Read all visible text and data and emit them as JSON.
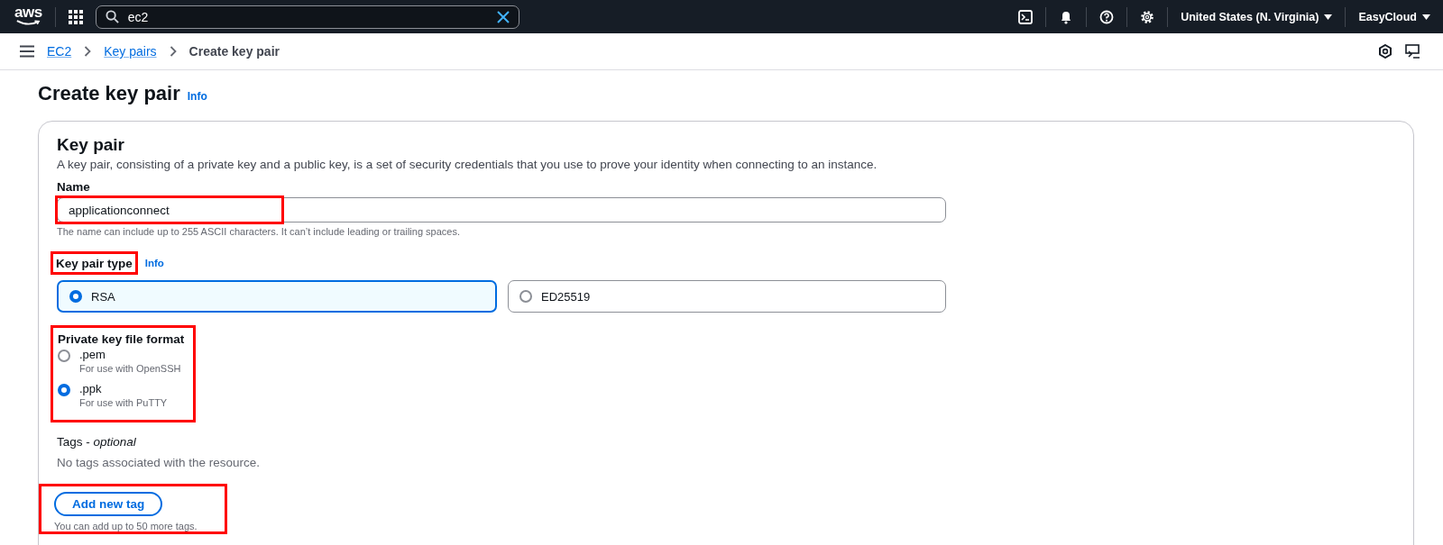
{
  "top_bar": {
    "logo": "aws",
    "search": {
      "value": "ec2"
    },
    "region": "United States (N. Virginia)",
    "account": "EasyCloud"
  },
  "breadcrumbs": [
    {
      "label": "EC2",
      "link": true
    },
    {
      "label": "Key pairs",
      "link": true
    },
    {
      "label": "Create key pair",
      "link": false
    }
  ],
  "page": {
    "title": "Create key pair",
    "info": "Info"
  },
  "key_pair": {
    "heading": "Key pair",
    "description": "A key pair, consisting of a private key and a public key, is a set of security credentials that you use to prove your identity when connecting to an instance.",
    "name": {
      "label": "Name",
      "value": "applicationconnect",
      "hint": "The name can include up to 255 ASCII characters. It can’t include leading or trailing spaces.",
      "highlighted": true
    },
    "type": {
      "label": "Key pair type",
      "info": "Info",
      "highlighted": true,
      "options": [
        {
          "label": "RSA",
          "selected": true
        },
        {
          "label": "ED25519",
          "selected": false
        }
      ]
    },
    "file_format": {
      "label": "Private key file format",
      "highlighted": true,
      "options": [
        {
          "label": ".pem",
          "description": "For use with OpenSSH",
          "selected": false
        },
        {
          "label": ".ppk",
          "description": "For use with PuTTY",
          "selected": true
        }
      ]
    },
    "tags": {
      "label": "Tags - *optional*",
      "empty_text": "No tags associated with the resource.",
      "add_button": "Add new tag",
      "limit_hint": "You can add up to 50 more tags.",
      "highlighted": true
    }
  }
}
